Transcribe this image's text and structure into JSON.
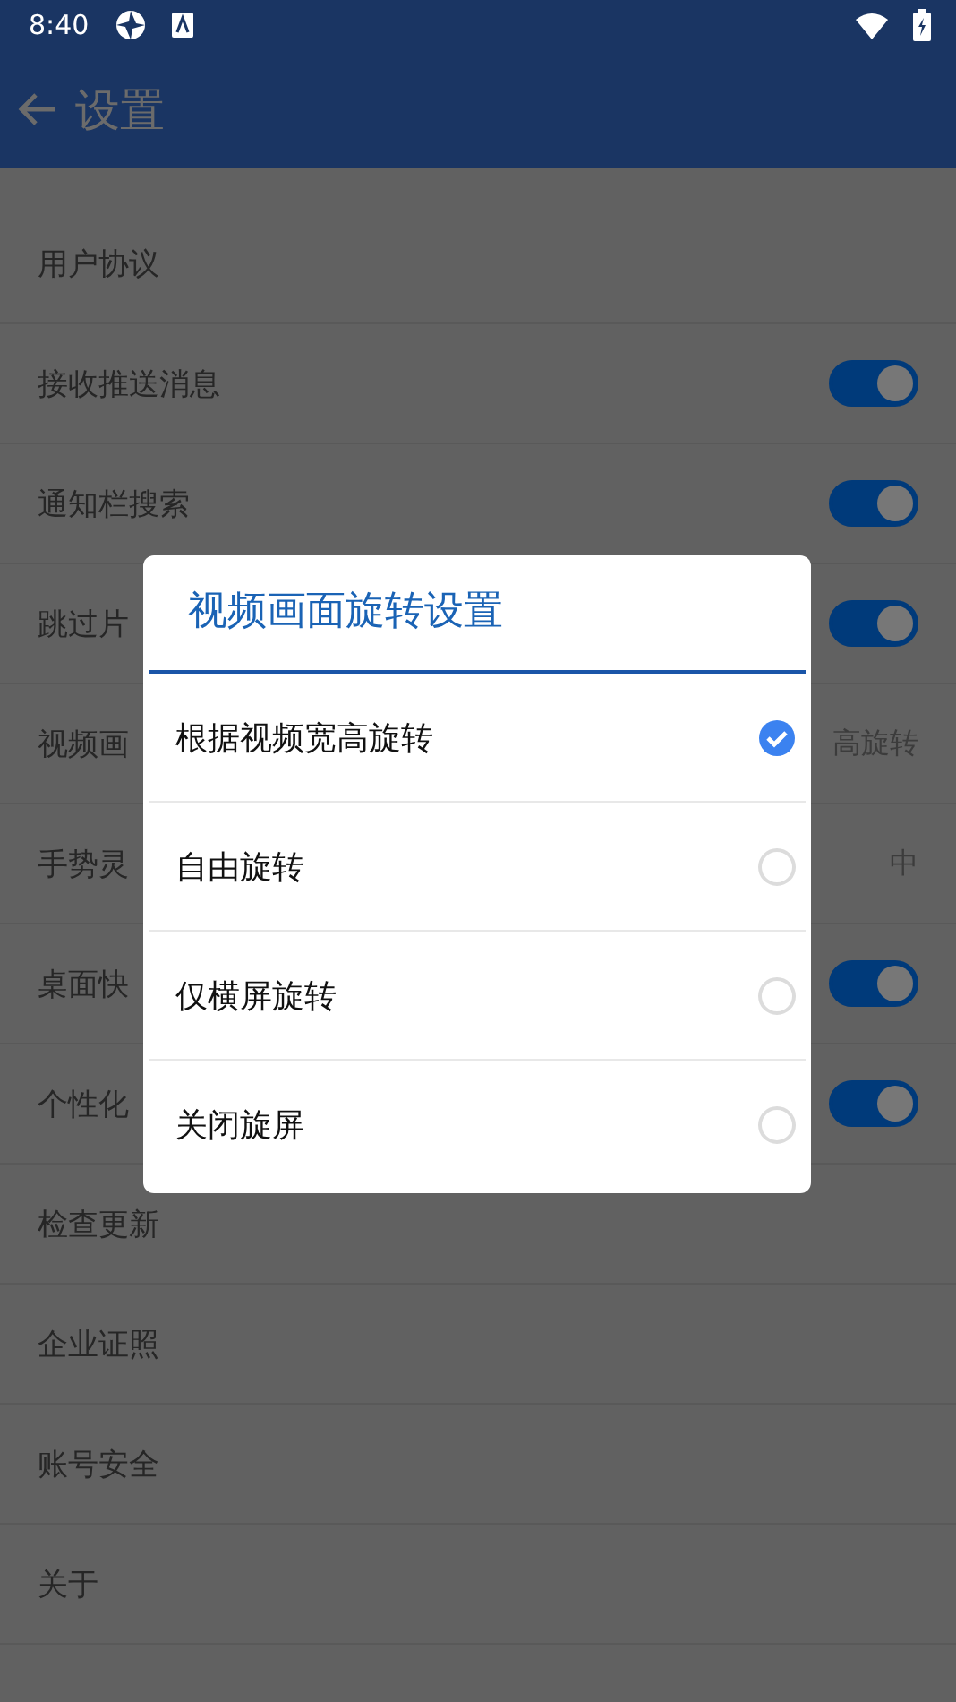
{
  "status_bar": {
    "time": "8:40"
  },
  "app_bar": {
    "title": "设置"
  },
  "settings": [
    {
      "label": "用户协议",
      "kind": "plain"
    },
    {
      "label": "接收推送消息",
      "kind": "toggle",
      "on": true
    },
    {
      "label": "通知栏搜索",
      "kind": "toggle",
      "on": true
    },
    {
      "label": "跳过片",
      "kind": "toggle",
      "on": true
    },
    {
      "label": "视频画",
      "kind": "value",
      "value": "高旋转"
    },
    {
      "label": "手势灵",
      "kind": "value",
      "value": "中"
    },
    {
      "label": "桌面快",
      "kind": "toggle",
      "on": true
    },
    {
      "label": "个性化",
      "kind": "toggle",
      "on": true
    },
    {
      "label": "检查更新",
      "kind": "plain"
    },
    {
      "label": "企业证照",
      "kind": "plain"
    },
    {
      "label": "账号安全",
      "kind": "plain"
    },
    {
      "label": "关于",
      "kind": "plain"
    }
  ],
  "dialog": {
    "title": "视频画面旋转设置",
    "options": [
      {
        "label": "根据视频宽高旋转",
        "selected": true
      },
      {
        "label": "自由旋转",
        "selected": false
      },
      {
        "label": "仅横屏旋转",
        "selected": false
      },
      {
        "label": "关闭旋屏",
        "selected": false
      }
    ]
  }
}
